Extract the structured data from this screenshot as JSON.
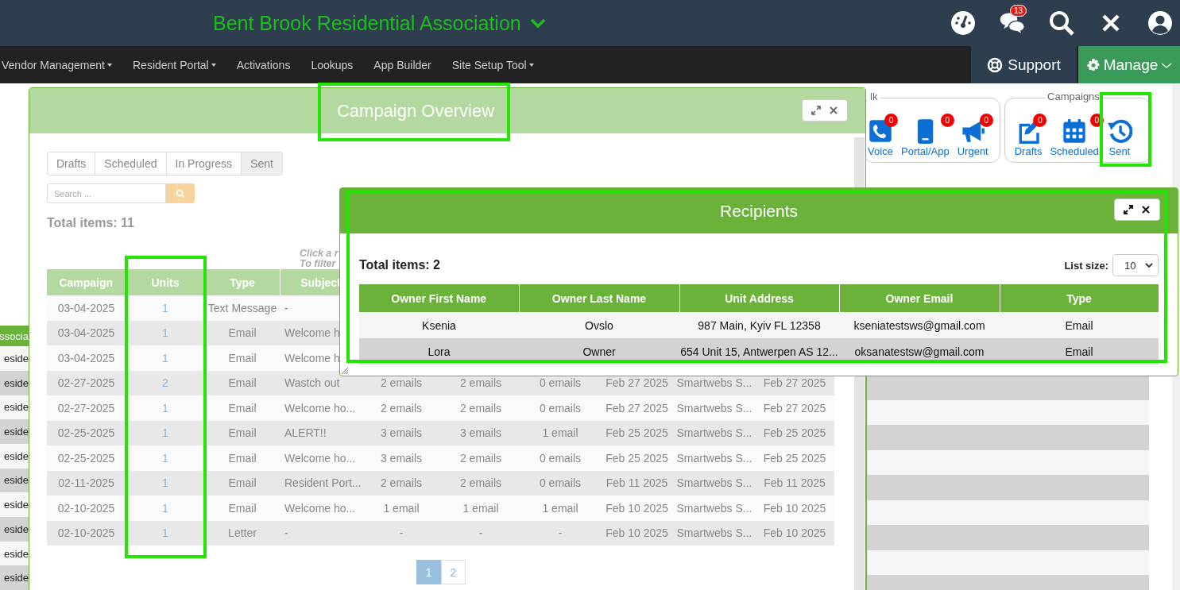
{
  "header": {
    "title": "Bent Brook Residential Association",
    "chat_badge": "13"
  },
  "nav": {
    "items": [
      {
        "label": "Vendor Management",
        "dropdown": true
      },
      {
        "label": "Resident Portal",
        "dropdown": true
      },
      {
        "label": "Activations",
        "dropdown": false
      },
      {
        "label": "Lookups",
        "dropdown": false
      },
      {
        "label": "App Builder",
        "dropdown": false
      },
      {
        "label": "Site Setup Tool",
        "dropdown": true
      }
    ],
    "support": "Support",
    "manage": "Manage"
  },
  "background_list": {
    "rows": [
      {
        "label": "ssocia",
        "kind": "header"
      },
      {
        "label": "eside",
        "kind": "row"
      },
      {
        "label": "eside",
        "kind": "row"
      },
      {
        "label": "eside",
        "kind": "row"
      },
      {
        "label": "eside",
        "kind": "row"
      },
      {
        "label": "eside",
        "kind": "row"
      },
      {
        "label": "eside",
        "kind": "row"
      },
      {
        "label": "eside",
        "kind": "row"
      },
      {
        "label": "eside",
        "kind": "row"
      },
      {
        "label": "eside",
        "kind": "row"
      },
      {
        "label": "eside",
        "kind": "row"
      }
    ]
  },
  "quick_actions": {
    "groups": [
      {
        "label": "lk",
        "items": [
          {
            "label": "Voice",
            "badge": "0"
          },
          {
            "label": "Portal/App",
            "badge": "0"
          },
          {
            "label": "Urgent",
            "badge": "0"
          }
        ]
      },
      {
        "label": "Campaigns",
        "items": [
          {
            "label": "Drafts",
            "badge": "0"
          },
          {
            "label": "Scheduled",
            "badge": "0"
          },
          {
            "label": "Sent"
          }
        ]
      }
    ]
  },
  "campaign_overview": {
    "title": "Campaign Overview",
    "tabs": [
      {
        "label": "Drafts",
        "selected": false
      },
      {
        "label": "Scheduled",
        "selected": false
      },
      {
        "label": "In Progress",
        "selected": false
      },
      {
        "label": "Sent",
        "selected": true
      }
    ],
    "search": {
      "placeholder": "Search ..."
    },
    "total": "Total items: 11",
    "hint_lines": [
      "Click a r",
      "To filter"
    ],
    "table": {
      "columns": [
        "Campaign",
        "Units",
        "Type",
        "Subject"
      ],
      "rows": [
        {
          "cells": [
            "03-04-2025",
            "1",
            "Text Message",
            "-"
          ]
        },
        {
          "cells": [
            "03-04-2025",
            "1",
            "Email",
            "Welcome h"
          ]
        },
        {
          "cells": [
            "03-04-2025",
            "1",
            "Email",
            "Welcome h"
          ]
        },
        {
          "cells": [
            "02-27-2025",
            "2",
            "Email",
            "Wastch out",
            "2 emails",
            "2 emails",
            "0 emails",
            "Feb 27 2025",
            "Smartwebs S...",
            "Feb 27 2025"
          ]
        },
        {
          "cells": [
            "02-27-2025",
            "1",
            "Email",
            "Welcome ho...",
            "2 emails",
            "2 emails",
            "0 emails",
            "Feb 27 2025",
            "Smartwebs S...",
            "Feb 27 2025"
          ]
        },
        {
          "cells": [
            "02-25-2025",
            "1",
            "Email",
            "ALERT!!",
            "3 emails",
            "3 emails",
            "1 email",
            "Feb 25 2025",
            "Smartwebs S...",
            "Feb 25 2025"
          ]
        },
        {
          "cells": [
            "02-25-2025",
            "1",
            "Email",
            "Welcome ho...",
            "3 emails",
            "2 emails",
            "0 emails",
            "Feb 25 2025",
            "Smartwebs S...",
            "Feb 25 2025"
          ]
        },
        {
          "cells": [
            "02-11-2025",
            "1",
            "Email",
            "Resident Port...",
            "2 emails",
            "2 emails",
            "0 emails",
            "Feb 11 2025",
            "Smartwebs S...",
            "Feb 11 2025"
          ]
        },
        {
          "cells": [
            "02-10-2025",
            "1",
            "Email",
            "Welcome ho...",
            "1 email",
            "1 email",
            "1 email",
            "Feb 10 2025",
            "Smartwebs S...",
            "Feb 10 2025"
          ]
        },
        {
          "cells": [
            "02-10-2025",
            "1",
            "Letter",
            "-",
            "-",
            "-",
            "-",
            "Feb 10 2025",
            "Smartwebs S...",
            "Feb 10 2025"
          ]
        }
      ]
    },
    "pagination": [
      {
        "label": "1",
        "selected": true
      },
      {
        "label": "2",
        "selected": false
      }
    ]
  },
  "recipients": {
    "title": "Recipients",
    "total": "Total items: 2",
    "list_size_label": "List size:",
    "list_size": "10",
    "table": {
      "columns": [
        "Owner First Name",
        "Owner Last Name",
        "Unit Address",
        "Owner Email",
        "Type"
      ],
      "rows": [
        {
          "cells": [
            "Ksenia",
            "Ovslo",
            "987 Main, Kyiv FL 12358",
            "kseniatestsws@gmail.com",
            "Email"
          ]
        },
        {
          "cells": [
            "Lora",
            "Owner",
            "654 Unit 15, Antwerpen AS 12...",
            "oksanatestsw@gmail.com",
            "Email"
          ]
        }
      ]
    }
  }
}
